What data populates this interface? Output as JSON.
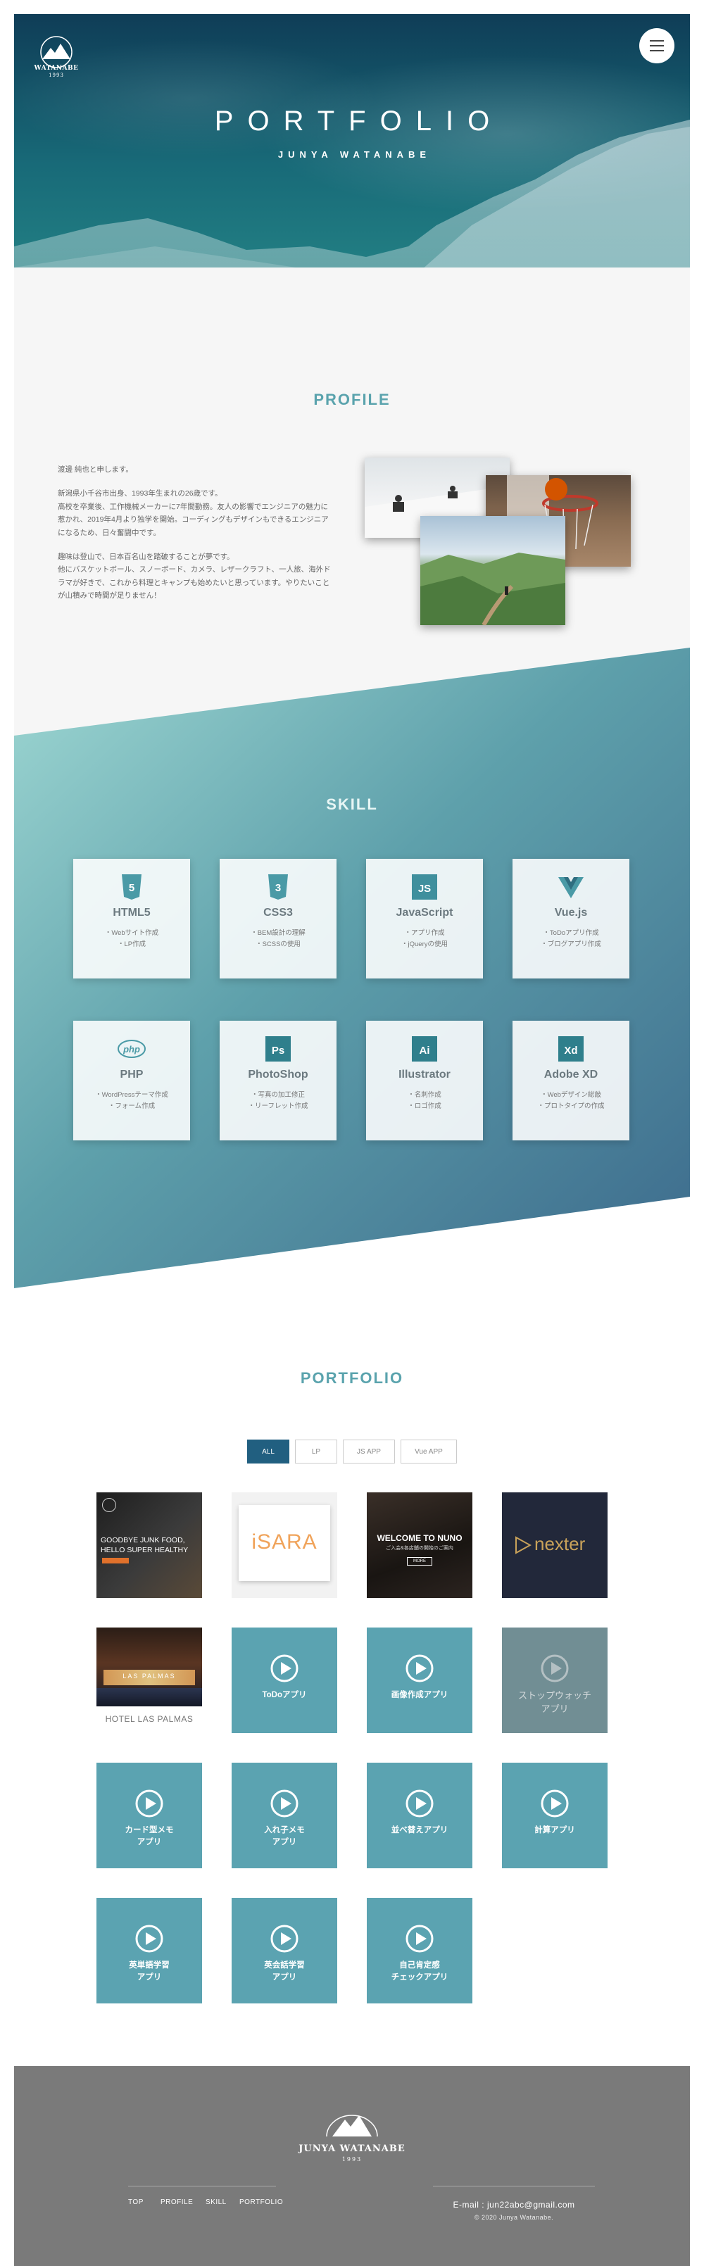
{
  "hero": {
    "logo_text": "WATANABE",
    "logo_year": "1993",
    "title": "PORTFOLIO",
    "subtitle": "JUNYA WATANABE",
    "menu_icon": "hamburger-icon"
  },
  "profile": {
    "title": "PROFILE",
    "paragraphs": [
      "渡邊 純也と申します。",
      "新潟県小千谷市出身、1993年生まれの26歳です。\n高校を卒業後、工作機械メーカーに7年間勤務。友人の影響でエンジニアの魅力に惹かれ、2019年4月より独学を開始。コーディングもデザインもできるエンジニアになるため、日々奮闘中です。",
      "趣味は登山で、日本百名山を踏破することが夢です。\n他にバスケットボール、スノーボード、カメラ、レザークラフト、一人旅、海外ドラマが好きで、これから料理とキャンプも始めたいと思っています。やりたいことが山積みで時間が足りません！"
    ]
  },
  "skill": {
    "title": "SKILL",
    "cards": [
      {
        "name": "HTML5",
        "icon": "html5-icon",
        "lines": [
          "・Webサイト作成",
          "・LP作成"
        ]
      },
      {
        "name": "CSS3",
        "icon": "css3-icon",
        "lines": [
          "・BEM設計の理解",
          "・SCSSの使用"
        ]
      },
      {
        "name": "JavaScript",
        "icon": "javascript-icon",
        "lines": [
          "・アプリ作成",
          "・jQueryの使用"
        ]
      },
      {
        "name": "Vue.js",
        "icon": "vuejs-icon",
        "lines": [
          "・ToDoアプリ作成",
          "・ブログアプリ作成"
        ]
      },
      {
        "name": "PHP",
        "icon": "php-icon",
        "lines": [
          "・WordPressテーマ作成",
          "・フォーム作成"
        ]
      },
      {
        "name": "PhotoShop",
        "icon": "photoshop-icon",
        "lines": [
          "・写真の加工修正",
          "・リーフレット作成"
        ]
      },
      {
        "name": "Illustrator",
        "icon": "illustrator-icon",
        "lines": [
          "・名刺作成",
          "・ロゴ作成"
        ]
      },
      {
        "name": "Adobe XD",
        "icon": "adobe-xd-icon",
        "lines": [
          "・Webデザイン総敲",
          "・プロトタイプの作成"
        ]
      }
    ]
  },
  "portfolio": {
    "title": "PORTFOLIO",
    "tabs": [
      "ALL",
      "LP",
      "JS APP",
      "Vue APP"
    ],
    "active_tab": "ALL",
    "thumb1": {
      "line1": "GOODBYE JUNK FOOD,",
      "line2": "HELLO SUPER HEALTHY"
    },
    "thumb2": {
      "text": "iSARA"
    },
    "thumb3": {
      "line1": "WELCOME TO NUNO",
      "line2": "ご入会&各店舗の開始のご案内",
      "button": "MORE"
    },
    "thumb4": {
      "text": "nexter"
    },
    "thumb5": {
      "sign": "LAS PALMAS",
      "caption": "HOTEL LAS PALMAS"
    },
    "apps": [
      "ToDoアプリ",
      "画像作成アプリ",
      "ストップウォッチ\nアプリ",
      "カード型メモ\nアプリ",
      "入れ子メモ\nアプリ",
      "並べ替えアプリ",
      "計算アプリ",
      "英単語学習\nアプリ",
      "英会話学習\nアプリ",
      "自己肯定感\nチェックアプリ"
    ]
  },
  "footer": {
    "brand": "JUNYA WATANABE",
    "year": "1993",
    "nav": [
      "TOP",
      "PROFILE",
      "SKILL",
      "PORTFOLIO"
    ],
    "email": "E-mail : jun22abc@gmail.com",
    "copyright": "© 2020 Junya Watanabe."
  },
  "colors": {
    "accent": "#5aa3ad",
    "tile": "#5ba3b1",
    "active_tab": "#215f80",
    "footer_bg": "#7a7a7a"
  }
}
